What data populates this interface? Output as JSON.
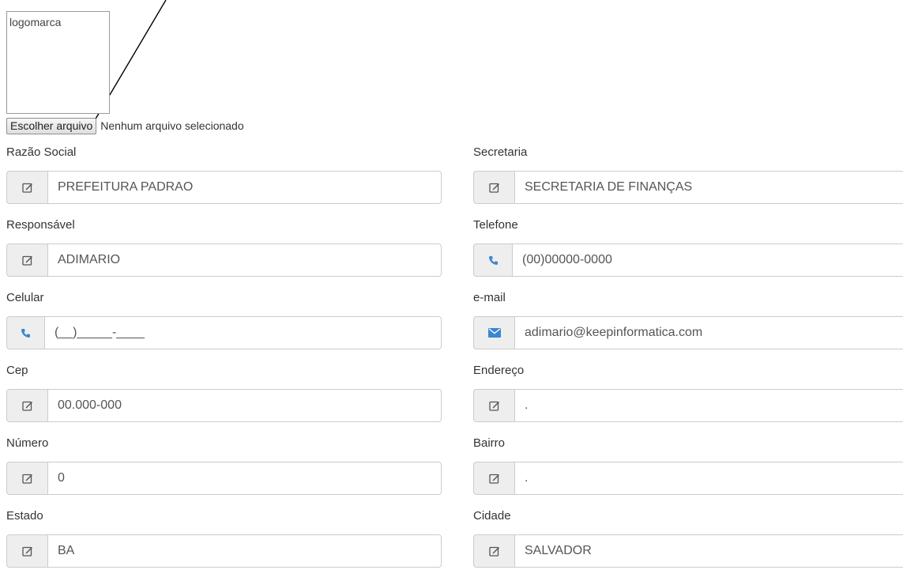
{
  "logo": {
    "label": "logomarca"
  },
  "file": {
    "button_label": "Escolher arquivo",
    "status": "Nenhum arquivo selecionado"
  },
  "colors": {
    "addon_bg": "#eeeeee",
    "border": "#cccccc",
    "phone_icon": "#3a87cf",
    "envelope_icon": "#3a87cf"
  },
  "form": {
    "razao_social": {
      "label": "Razão Social",
      "value": "PREFEITURA PADRAO",
      "icon": "edit-icon"
    },
    "secretaria": {
      "label": "Secretaria",
      "value": "SECRETARIA DE FINANÇAS",
      "icon": "edit-icon"
    },
    "responsavel": {
      "label": "Responsável",
      "value": "ADIMARIO",
      "icon": "edit-icon"
    },
    "telefone": {
      "label": "Telefone",
      "value": "(00)00000-0000",
      "icon": "phone-icon"
    },
    "celular": {
      "label": "Celular",
      "value": "(__)_____-____",
      "icon": "phone-icon"
    },
    "email": {
      "label": "e-mail",
      "value": "adimario@keepinformatica.com",
      "icon": "envelope-icon"
    },
    "cep": {
      "label": "Cep",
      "value": "00.000-000",
      "icon": "edit-icon"
    },
    "endereco": {
      "label": "Endereço",
      "value": ".",
      "icon": "edit-icon"
    },
    "numero": {
      "label": "Número",
      "value": "0",
      "icon": "edit-icon"
    },
    "bairro": {
      "label": "Bairro",
      "value": ".",
      "icon": "edit-icon"
    },
    "estado": {
      "label": "Estado",
      "value": "BA",
      "icon": "edit-icon"
    },
    "cidade": {
      "label": "Cidade",
      "value": "SALVADOR",
      "icon": "edit-icon"
    }
  }
}
